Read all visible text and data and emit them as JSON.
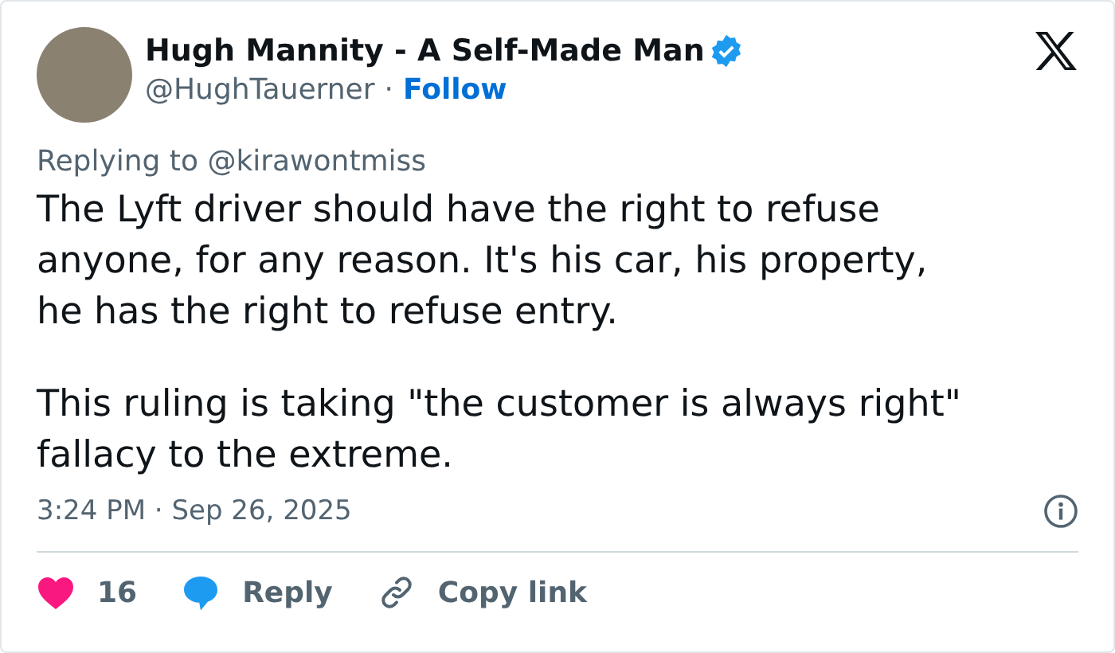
{
  "author": {
    "name": "Hugh Mannity - A Self-Made Man",
    "verified": true,
    "handle": "@HughTauerner",
    "separator": "·",
    "follow": "Follow"
  },
  "replying_to": "Replying to @kirawontmiss",
  "paragraphs": [
    "The Lyft driver should have the right to refuse\nanyone, for any reason. It's his car, his property,\nhe has the right to refuse entry.",
    "This ruling is taking \"the customer is always right\"\nfallacy to the extreme."
  ],
  "timestamp": "3:24 PM · Sep 26, 2025",
  "actions": [
    {
      "kind": "like",
      "label": "16"
    },
    {
      "kind": "reply",
      "label": "Reply"
    },
    {
      "kind": "copy",
      "label": "Copy link"
    }
  ]
}
